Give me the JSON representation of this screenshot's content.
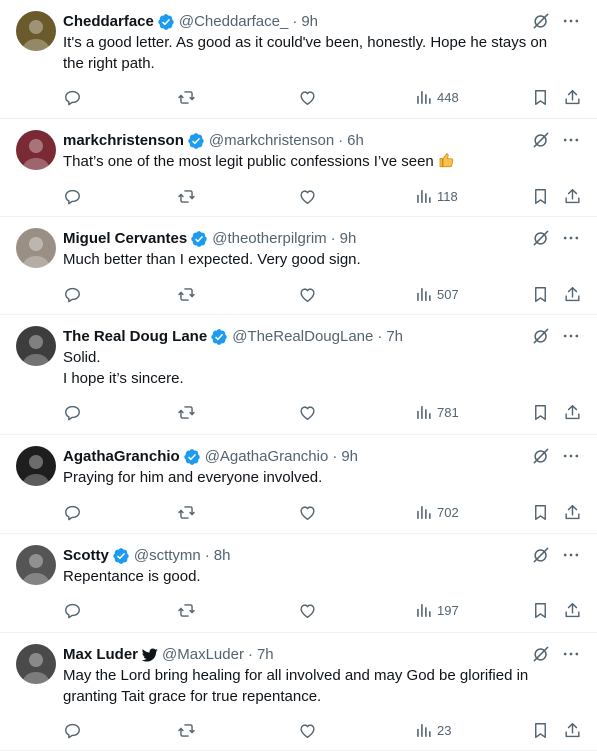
{
  "tweets": [
    {
      "name": "Cheddarface",
      "handle": "@Cheddarface_",
      "time": "9h",
      "badge": "verified",
      "text": "It's a good letter. As good as it could've been, honestly. Hope he stays on the right path.",
      "views": "448",
      "avatar_color": "#6b5a2b"
    },
    {
      "name": "markchristenson",
      "handle": "@markchristenson",
      "time": "6h",
      "badge": "verified",
      "text": "That’s one of the most legit public confessions I’ve seen",
      "emoji": "thumbs-up-icon",
      "views": "118",
      "avatar_color": "#7a2a34"
    },
    {
      "name": "Miguel Cervantes",
      "handle": "@theotherpilgrim",
      "time": "9h",
      "badge": "verified",
      "text": "Much better than I expected. Very good sign.",
      "views": "507",
      "avatar_color": "#9a8f84"
    },
    {
      "name": "The Real Doug Lane",
      "handle": "@TheRealDougLane",
      "time": "7h",
      "badge": "verified",
      "text": "Solid.\nI hope it’s sincere.",
      "views": "781",
      "avatar_color": "#3d3d3d"
    },
    {
      "name": "AgathaGranchio",
      "handle": "@AgathaGranchio",
      "time": "9h",
      "badge": "verified",
      "text": "Praying for him and everyone involved.",
      "views": "702",
      "avatar_color": "#1e1e1e"
    },
    {
      "name": "Scotty",
      "handle": "@scttymn",
      "time": "8h",
      "badge": "verified",
      "text": "Repentance is good.",
      "views": "197",
      "avatar_color": "#555555"
    },
    {
      "name": "Max Luder",
      "handle": "@MaxLuder",
      "time": "7h",
      "badge": "bird",
      "text": "May the Lord bring healing for all involved and may God be glorified in granting Tait grace for true repentance.",
      "views": "23",
      "avatar_color": "#4a4a4a"
    }
  ],
  "colors": {
    "text": "#0f1419",
    "muted": "#536471",
    "verified": "#1d9bf0",
    "divider": "#eff3f4"
  }
}
